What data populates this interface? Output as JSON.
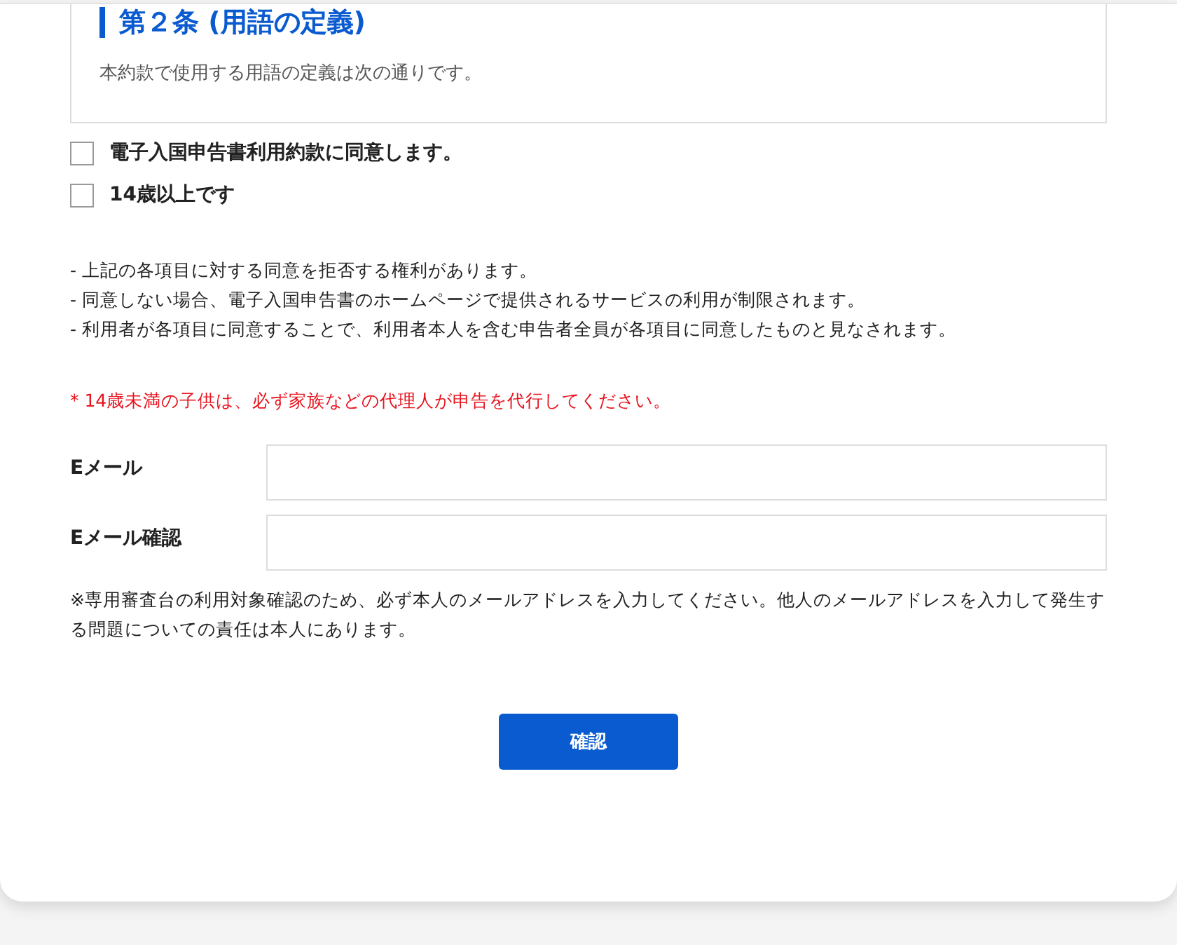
{
  "terms_box": {
    "heading": "第２条 (用語の定義)",
    "paragraph": "本約款で使用する用語の定義は次の通りです。"
  },
  "agreements": [
    {
      "label": "電子入国申告書利用約款に同意します。",
      "checked": false
    },
    {
      "label": "14歳以上です",
      "checked": false
    }
  ],
  "notices": [
    "- 上記の各項目に対する同意を拒否する権利があります。",
    "- 同意しない場合、電子入国申告書のホームページで提供されるサービスの利用が制限されます。",
    "- 利用者が各項目に同意することで、利用者本人を含む申告者全員が各項目に同意したものと見なされます。"
  ],
  "warning": "* 14歳未満の子供は、必ず家族などの代理人が申告を代行してください。",
  "fields": [
    {
      "label": "Eメール"
    },
    {
      "label": "Eメール確認"
    }
  ],
  "email_note": "※専用審査台の利用対象確認のため、必ず本人のメールアドレスを入力してください。他人のメールアドレスを入力して発生する問題についての責任は本人にあります。",
  "confirm_button": "確認"
}
